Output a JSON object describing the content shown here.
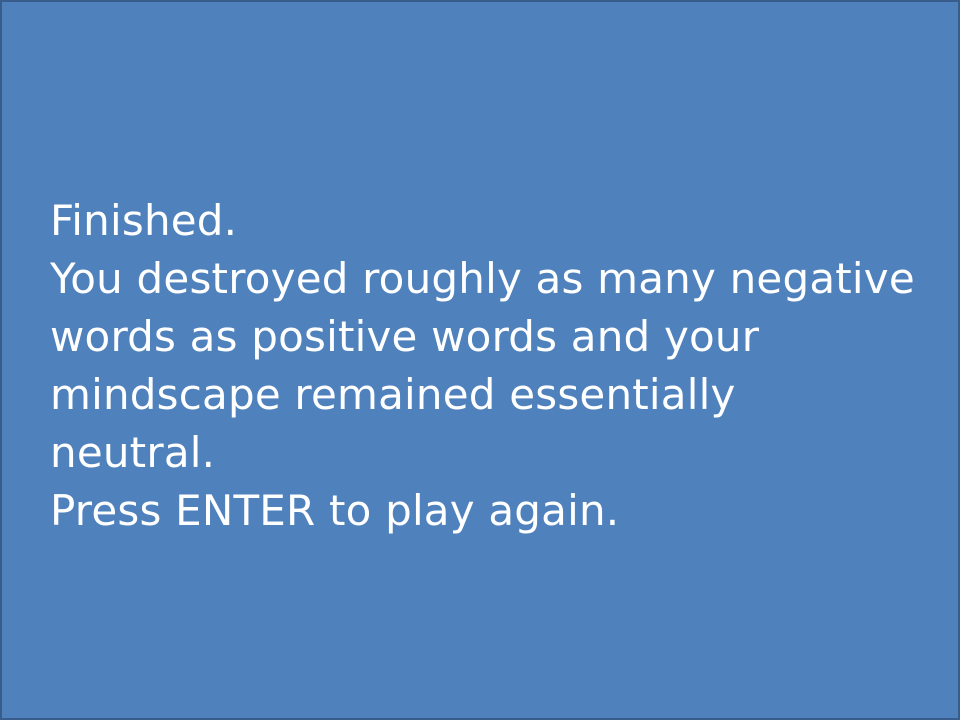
{
  "end_screen": {
    "title": "Finished.",
    "result_lines": [
      "You destroyed roughly as many negative",
      "words as positive words and your",
      "mindscape remained essentially",
      "neutral."
    ],
    "prompt": "Press ENTER to play again."
  },
  "colors": {
    "background": "#4f81bd",
    "border": "#385d8a",
    "text": "#ffffff"
  }
}
